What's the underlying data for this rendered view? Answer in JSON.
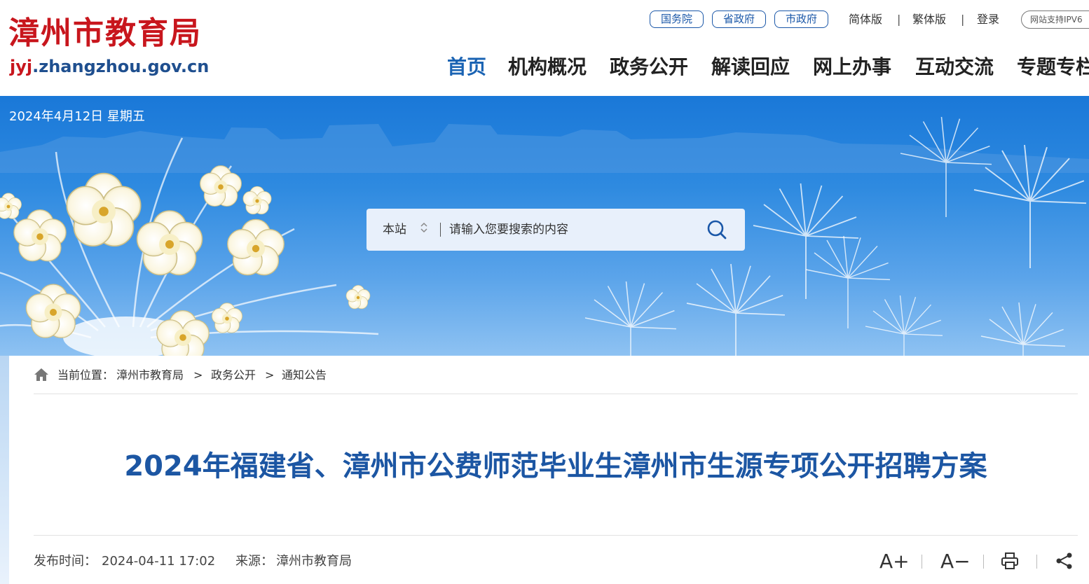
{
  "header": {
    "logo_cn": "漳州市教育局",
    "logo_url_highlight": "jyj",
    "logo_url_rest": ".zhangzhou.gov.cn",
    "gov_links": [
      "国务院",
      "省政府",
      "市政府"
    ],
    "lang_simplified": "简体版",
    "lang_traditional": "繁体版",
    "login": "登录",
    "separator": "|",
    "ipv6_badge": "网站支持IPV6",
    "nav": [
      "首页",
      "机构概况",
      "政务公开",
      "解读回应",
      "网上办事",
      "互动交流",
      "专题专栏"
    ]
  },
  "banner": {
    "date": "2024年4月12日 星期五"
  },
  "search": {
    "scope": "本站",
    "scope_arrows": "⬍",
    "placeholder": "请输入您要搜索的内容",
    "icon": "search-icon"
  },
  "breadcrumb": {
    "label": "当前位置：",
    "items": [
      "漳州市教育局",
      "政务公开",
      "通知公告"
    ],
    "separator": ">"
  },
  "article": {
    "title": "2024年福建省、漳州市公费师范毕业生漳州市生源专项公开招聘方案",
    "publish_label": "发布时间：",
    "publish_time": "2024-04-11 17:02",
    "source_label": "来源：",
    "source": "漳州市教育局"
  },
  "tools": {
    "font_increase": "A+",
    "font_decrease": "A−",
    "print_icon": "print-icon",
    "share_icon": "share-icon"
  },
  "colors": {
    "logo_red": "#c8161d",
    "brand_blue": "#1c56a3",
    "nav_active": "#1a63b3",
    "banner_sky": "#2e8ae0"
  }
}
